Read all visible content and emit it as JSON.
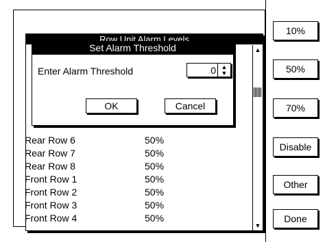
{
  "side_buttons": [
    "10%",
    "50%",
    "70%",
    "Disable",
    "Other",
    "Done"
  ],
  "list_window": {
    "title": "Row Unit Alarm Levels",
    "rows": [
      {
        "name": "Rear Row 6",
        "value": "50%"
      },
      {
        "name": "Rear Row 7",
        "value": "50%"
      },
      {
        "name": "Rear Row 8",
        "value": "50%"
      },
      {
        "name": "Front Row 1",
        "value": "50%"
      },
      {
        "name": "Front Row 2",
        "value": "50%"
      },
      {
        "name": "Front Row 3",
        "value": "50%"
      },
      {
        "name": "Front Row 4",
        "value": "50%"
      }
    ]
  },
  "dialog": {
    "title": "Set Alarm Threshold",
    "label": "Enter Alarm Threshold",
    "value": "0",
    "ok_label": "OK",
    "cancel_label": "Cancel"
  },
  "icons": {
    "stepper": "up-down-arrows-icon",
    "scroll_up": "triangle-up-icon",
    "scroll_down": "triangle-down-icon"
  }
}
